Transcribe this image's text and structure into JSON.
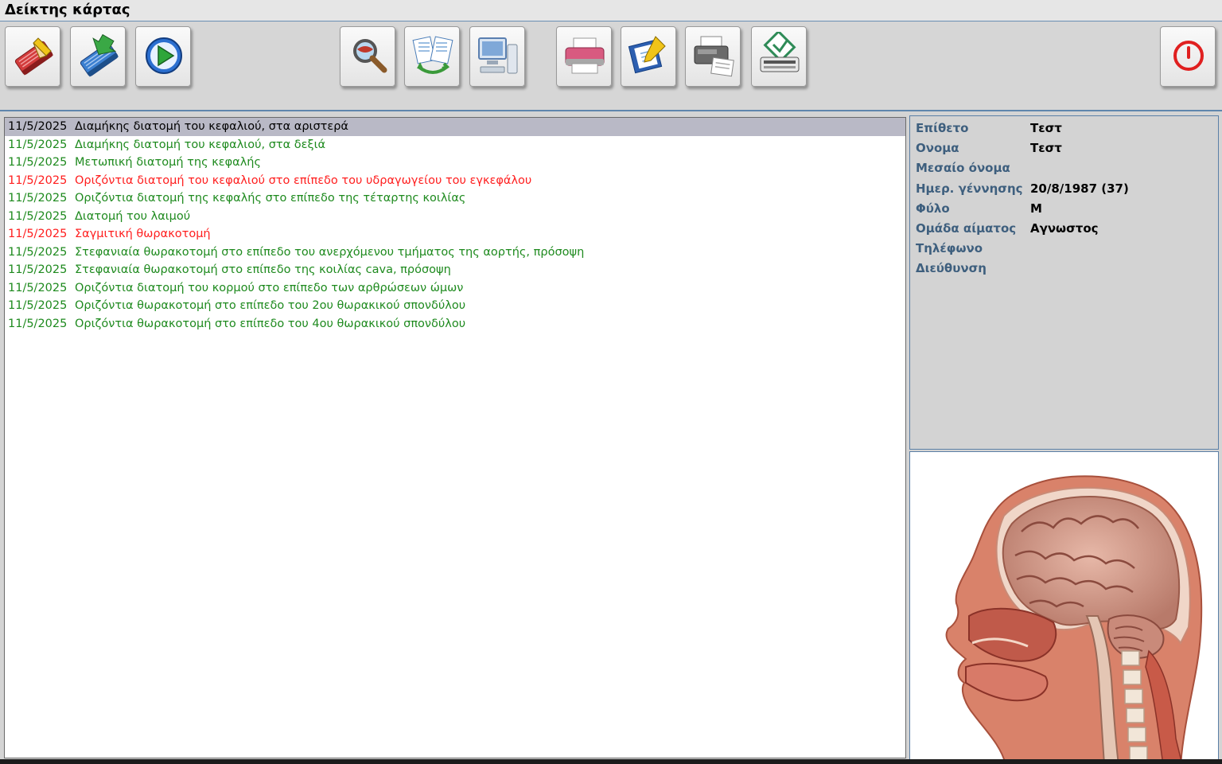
{
  "window": {
    "title": "Δείκτης κάρτας"
  },
  "toolbar": {
    "buttons": [
      {
        "name": "new-record-icon",
        "color": "#c0392b"
      },
      {
        "name": "import-record-icon",
        "color": "#2d6fb5"
      },
      {
        "name": "play-icon",
        "color": "#2e9e3a"
      },
      {
        "name": "zoom-icon",
        "color": "#8a4b2a"
      },
      {
        "name": "swap-icon",
        "color": "#3a9a3a"
      },
      {
        "name": "computer-icon",
        "color": "#5a7fb0"
      },
      {
        "name": "printer-icon",
        "color": "#c45a78"
      },
      {
        "name": "edit-document-icon",
        "color": "#2d5fb0"
      },
      {
        "name": "fax-icon",
        "color": "#555555"
      },
      {
        "name": "scanner-icon",
        "color": "#2e8b57"
      },
      {
        "name": "power-icon",
        "color": "#e02020"
      }
    ]
  },
  "records": {
    "colors": {
      "normal": "#1e8a1e",
      "alert": "#ff1e1e",
      "selected": "#000000"
    },
    "items": [
      {
        "date": "11/5/2025",
        "text": "Διαμήκης διατομή του κεφαλιού, στα αριστερά",
        "status": "selected"
      },
      {
        "date": "11/5/2025",
        "text": "Διαμήκης διατομή του κεφαλιού, στα δεξιά",
        "status": "normal"
      },
      {
        "date": "11/5/2025",
        "text": "Μετωπική διατομή της κεφαλής",
        "status": "normal"
      },
      {
        "date": "11/5/2025",
        "text": "Οριζόντια διατομή του κεφαλιού στο επίπεδο του υδραγωγείου του εγκεφάλου",
        "status": "alert"
      },
      {
        "date": "11/5/2025",
        "text": "Οριζόντια διατομή της κεφαλής στο επίπεδο της τέταρτης κοιλίας",
        "status": "normal"
      },
      {
        "date": "11/5/2025",
        "text": "Διατομή του λαιμού",
        "status": "normal"
      },
      {
        "date": "11/5/2025",
        "text": "Σαγμιτική θωρακοτομή",
        "status": "alert"
      },
      {
        "date": "11/5/2025",
        "text": "Στεφανιαία θωρακοτομή στο επίπεδο του ανερχόμενου τμήματος της αορτής, πρόσοψη",
        "status": "normal"
      },
      {
        "date": "11/5/2025",
        "text": "Στεφανιαία θωρακοτομή στο επίπεδο της κοιλίας cava, πρόσοψη",
        "status": "normal"
      },
      {
        "date": "11/5/2025",
        "text": "Οριζόντια διατομή του κορμού στο επίπεδο των αρθρώσεων ώμων",
        "status": "normal"
      },
      {
        "date": "11/5/2025",
        "text": "Οριζόντια θωρακοτομή στο επίπεδο του 2ου θωρακικού σπονδύλου",
        "status": "normal"
      },
      {
        "date": "11/5/2025",
        "text": "Οριζόντια θωρακοτομή στο επίπεδο του 4ου θωρακικού σπονδύλου",
        "status": "normal"
      }
    ]
  },
  "patient": {
    "fields": [
      {
        "label": "Επίθετο",
        "value": "Τεστ"
      },
      {
        "label": "Ονομα",
        "value": "Τεστ"
      },
      {
        "label": "Μεσαίο όνομα",
        "value": ""
      },
      {
        "label": "Ημερ. γέννησης",
        "value": "20/8/1987 (37)"
      },
      {
        "label": "Φύλο",
        "value": "Μ"
      },
      {
        "label": "Ομάδα αίματος",
        "value": "Αγνωστος"
      },
      {
        "label": "Τηλέφωνο",
        "value": ""
      },
      {
        "label": "Διεύθυνση",
        "value": ""
      }
    ]
  },
  "image": {
    "name": "head-sagittal-section-image"
  }
}
